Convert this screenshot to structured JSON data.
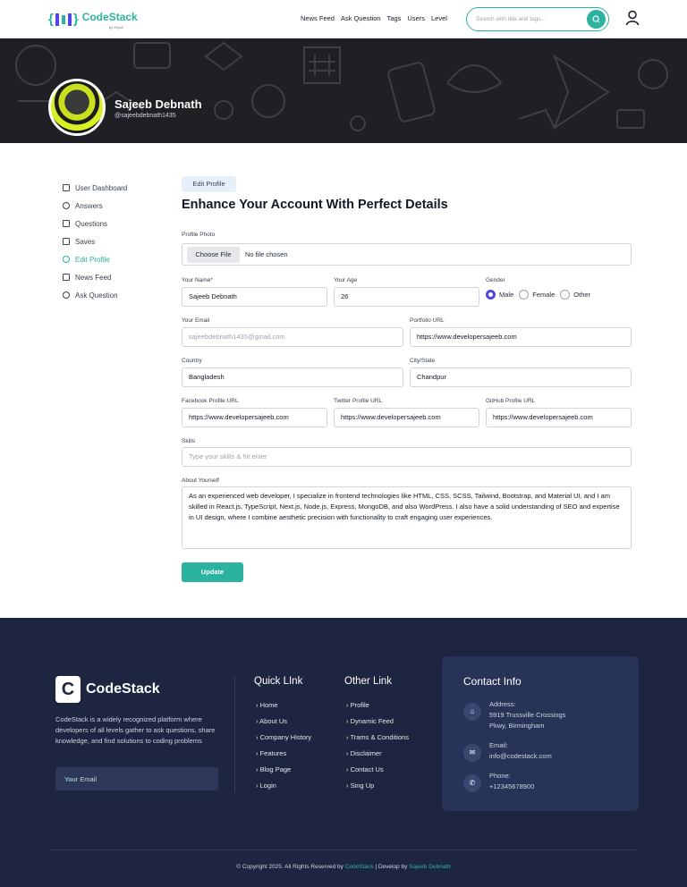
{
  "brand": {
    "name": "CodeStack",
    "sub": "by Zeps0"
  },
  "nav": [
    "News Feed",
    "Ask Question",
    "Tags",
    "Users",
    "Level"
  ],
  "search": {
    "placeholder": "Search with title and tags..."
  },
  "profile": {
    "name": "Sajeeb Debnath",
    "handle": "@sajeebdebnath1435"
  },
  "sidebar": [
    {
      "label": "User Dashboard",
      "icon": "grid-icon"
    },
    {
      "label": "Answers",
      "icon": "chat-icon"
    },
    {
      "label": "Questions",
      "icon": "question-icon"
    },
    {
      "label": "Saves",
      "icon": "bookmark-icon"
    },
    {
      "label": "Edit Profile",
      "icon": "user-edit-icon",
      "active": true
    },
    {
      "label": "News Feed",
      "icon": "feed-icon"
    },
    {
      "label": "Ask Question",
      "icon": "user-icon"
    }
  ],
  "form": {
    "tab": "Edit Profile",
    "heading": "Enhance Your Account With Perfect Details",
    "photo": {
      "label": "Profile Photo",
      "button": "Choose File",
      "status": "No file chosen"
    },
    "name": {
      "label": "Your Name*",
      "value": "Sajeeb Debnath"
    },
    "age": {
      "label": "Your Age",
      "value": "26"
    },
    "gender": {
      "label": "Gender",
      "options": [
        "Male",
        "Female",
        "Other"
      ],
      "selected": "Male"
    },
    "email": {
      "label": "Your Email",
      "value": "sajeebdebnath1435@gmail.com"
    },
    "portfolio": {
      "label": "Portfolio URL",
      "value": "https://www.developersajeeb.com"
    },
    "country": {
      "label": "Country",
      "value": "Bangladesh"
    },
    "city": {
      "label": "City/State",
      "value": "Chandpur"
    },
    "facebook": {
      "label": "Facebook Profile URL",
      "value": "https://www.developersajeeb.com"
    },
    "twitter": {
      "label": "Twitter Profile URL",
      "value": "https://www.developersajeeb.com"
    },
    "github": {
      "label": "GitHub Profile URL",
      "value": "https://www.developersajeeb.com"
    },
    "skills": {
      "label": "Skills",
      "placeholder": "Type your skills & hit enter"
    },
    "about": {
      "label": "About Yourself",
      "value": "As an experienced web developer, I specialize in frontend technologies like HTML, CSS, SCSS, Tailwind, Bootstrap, and Material UI, and I am skilled in React.js, TypeScript, Next.js, Node.js, Express, MongoDB, and also WordPress. I also have a solid understanding of SEO and expertise in UI design, where I combine aesthetic precision with functionality to craft engaging user experiences."
    },
    "submit": "Update"
  },
  "footer": {
    "logo": "CodeStack",
    "description": "CodeStack is a widely recognized platform where developers of all levels gather to ask questions, share knowledge, and find solutions to coding problems",
    "email_placeholder": "Your Email",
    "quick_title": "Quick LInk",
    "quick_links": [
      "Home",
      "About Us",
      "Company History",
      "Features",
      "Blog Page",
      "Login"
    ],
    "other_title": "Other Link",
    "other_links": [
      "Profile",
      "Dynamic Feed",
      "Trams & Conditions",
      "Disclaimer",
      "Contact Us",
      "Sing Up"
    ],
    "contact_title": "Contact Info",
    "address_label": "Address:",
    "address_lines": [
      "5919 Trussville Crossings",
      "Pkwy, Birmingham"
    ],
    "email_label": "Email:",
    "email_value": "info@codestack.com",
    "phone_label": "Phone:",
    "phone_value": "+12345678900",
    "copyright_prefix": "© Copyright 2025. All Rights Reserved by",
    "copyright_brand": "CodeStack",
    "copyright_mid": "| Develop by",
    "copyright_author": "Sajeeb Debnath"
  }
}
